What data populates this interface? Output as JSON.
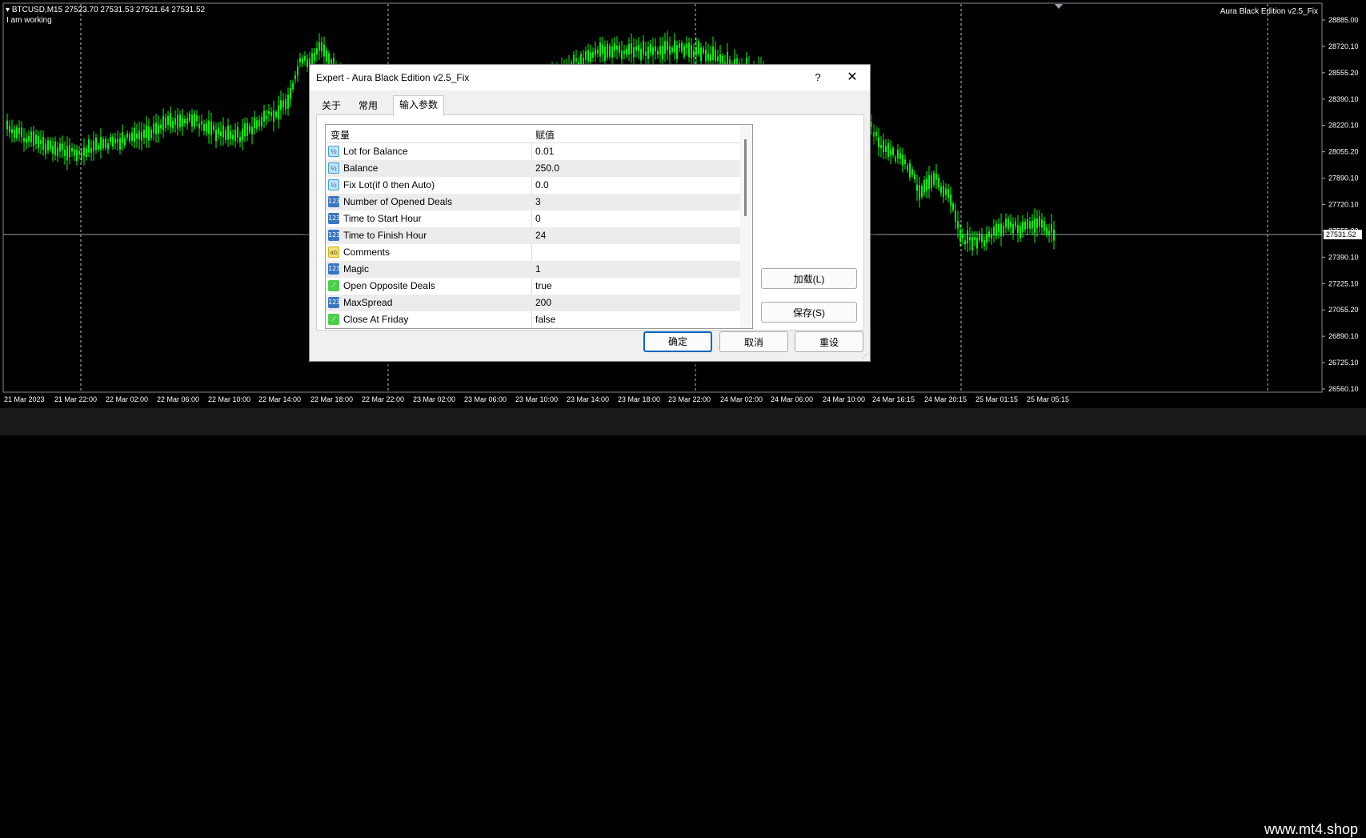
{
  "chart": {
    "symbol_line": "BTCUSD,M15  27523.70 27531.53 27521.64 27531.52",
    "status": "I am working",
    "ea_label": "Aura Black Edition v2.5_Fix",
    "current_price": "27531.52",
    "price_labels": [
      "28885.00",
      "28720.10",
      "28555.20",
      "28390.10",
      "28220.10",
      "28055.20",
      "27890.10",
      "27720.10",
      "27555.20",
      "27390.10",
      "27225.10",
      "27055.20",
      "26890.10",
      "26725.10",
      "26560.10"
    ],
    "time_labels": [
      "21 Mar 2023",
      "21 Mar 22:00",
      "22 Mar 02:00",
      "22 Mar 06:00",
      "22 Mar 10:00",
      "22 Mar 14:00",
      "22 Mar 18:00",
      "22 Mar 22:00",
      "23 Mar 02:00",
      "23 Mar 06:00",
      "23 Mar 10:00",
      "23 Mar 14:00",
      "23 Mar 18:00",
      "23 Mar 22:00",
      "24 Mar 02:00",
      "24 Mar 06:00",
      "24 Mar 10:00",
      "24 Mar 16:15",
      "24 Mar 20:15",
      "25 Mar 01:15",
      "25 Mar 05:15"
    ],
    "colors": {
      "candle": "#00ff00",
      "grid": "#c0c0c0",
      "text": "#ffffff",
      "background": "#000000"
    }
  },
  "dialog": {
    "title": "Expert - Aura Black Edition v2.5_Fix",
    "help_label": "?",
    "close_label": "✕",
    "tabs": [
      "关于",
      "常用",
      "输入参数"
    ],
    "grid_headers": {
      "variable": "变量",
      "value": "赋值"
    },
    "params": [
      {
        "icon": "double",
        "icon_text": "½",
        "name": "Lot for Balance",
        "value": "0.01"
      },
      {
        "icon": "double",
        "icon_text": "½",
        "name": "Balance",
        "value": "250.0"
      },
      {
        "icon": "double",
        "icon_text": "½",
        "name": "Fix Lot(if 0 then Auto)",
        "value": "0.0"
      },
      {
        "icon": "int",
        "icon_text": "123",
        "name": "Number of Opened Deals",
        "value": "3"
      },
      {
        "icon": "int",
        "icon_text": "123",
        "name": "Time to Start Hour",
        "value": "0"
      },
      {
        "icon": "int",
        "icon_text": "123",
        "name": "Time to Finish Hour",
        "value": "24"
      },
      {
        "icon": "string",
        "icon_text": "ab",
        "name": "Comments",
        "value": ""
      },
      {
        "icon": "int",
        "icon_text": "123",
        "name": "Magic",
        "value": "1"
      },
      {
        "icon": "bool",
        "icon_text": "⟋",
        "name": "Open Opposite Deals",
        "value": "true"
      },
      {
        "icon": "int",
        "icon_text": "123",
        "name": "MaxSpread",
        "value": "200"
      },
      {
        "icon": "bool",
        "icon_text": "⟋",
        "name": "Close At Friday",
        "value": "false"
      }
    ],
    "buttons": {
      "load": "加载(L)",
      "save": "保存(S)",
      "ok": "确定",
      "cancel": "取消",
      "reset": "重设"
    }
  },
  "watermark": "www.mt4.shop"
}
